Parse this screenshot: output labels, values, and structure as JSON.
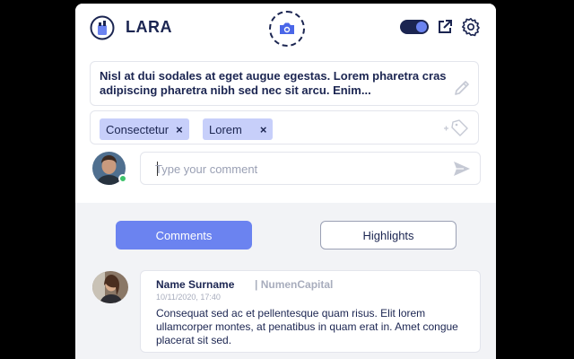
{
  "app": {
    "title": "LARA"
  },
  "header": {
    "logo_icon": "jar-logo-icon",
    "camera_icon": "camera-icon",
    "toggle_state": "on",
    "external_icon": "external-link-icon",
    "settings_icon": "gear-icon"
  },
  "quote": {
    "text": "Nisl at dui sodales at eget augue egestas. Lorem pharetra cras adipiscing pharetra nibh sed nec sit arcu. Enim...",
    "edit_icon": "pencil-icon"
  },
  "tags": [
    {
      "label": "Consectetur",
      "remove": "×"
    },
    {
      "label": "Lorem",
      "remove": "×"
    }
  ],
  "tag_add_icon": "add-tag-icon",
  "composer": {
    "placeholder": "Type your comment",
    "send_icon": "send-icon"
  },
  "tabs": {
    "comments": "Comments",
    "highlights": "Highlights"
  },
  "comment": {
    "name": "Name Surname",
    "org": "| NumenCapital",
    "date": "10/11/2020, 17:40",
    "text": "Consequat sed ac et pellentesque quam risus. Elit lorem ullamcorper montes, at penatibus in quam erat in. Amet congue placerat sit sed."
  },
  "colors": {
    "navy": "#1b2551",
    "accent": "#6b83f0",
    "tag_bg": "#c7cffa",
    "online": "#3cc26a"
  }
}
